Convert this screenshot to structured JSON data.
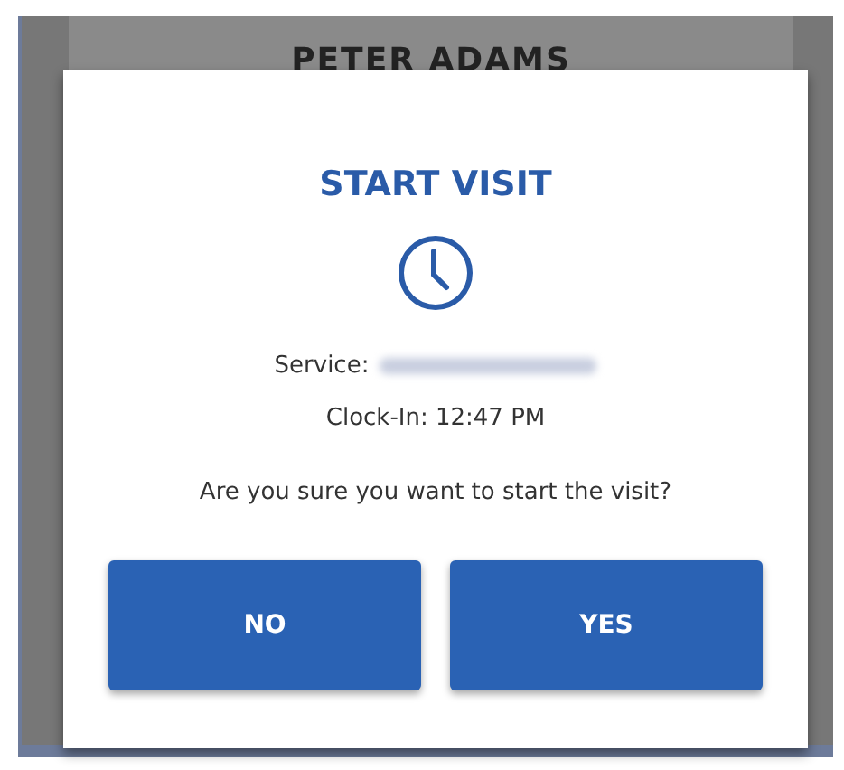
{
  "background": {
    "heading": "PETER ADAMS"
  },
  "dialog": {
    "title": "START VISIT",
    "service_label": "Service:",
    "clock_in": "Clock-In: 12:47 PM",
    "question": "Are you sure you want to start the visit?",
    "buttons": [
      {
        "label": "NO"
      },
      {
        "label": "YES"
      }
    ]
  }
}
